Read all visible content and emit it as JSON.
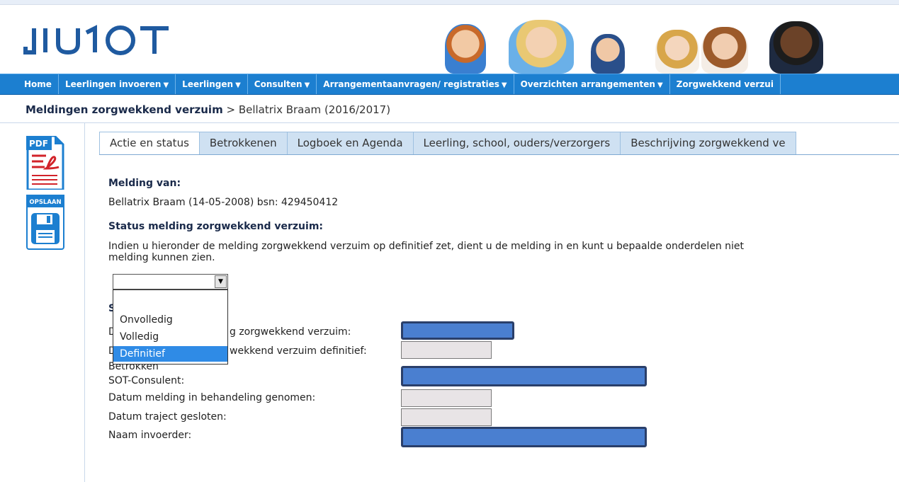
{
  "brand": {
    "logo_text": "ᒧᑌ1OT"
  },
  "nav": {
    "items": [
      {
        "label": "Home",
        "dropdown": false
      },
      {
        "label": "Leerlingen invoeren",
        "dropdown": true
      },
      {
        "label": "Leerlingen",
        "dropdown": true
      },
      {
        "label": "Consulten",
        "dropdown": true
      },
      {
        "label": "Arrangementaanvragen/ registraties",
        "dropdown": true
      },
      {
        "label": "Overzichten arrangementen",
        "dropdown": true
      },
      {
        "label": "Zorgwekkend verzui",
        "dropdown": false
      }
    ]
  },
  "breadcrumb": {
    "section": "Meldingen zorgwekkend verzuim",
    "separator": " > ",
    "current": "Bellatrix Braam (2016/2017)"
  },
  "sidebar": {
    "pdf_label": "PDF",
    "save_label": "OPSLAAN"
  },
  "tabs": [
    {
      "label": "Actie en status",
      "active": true
    },
    {
      "label": "Betrokkenen",
      "active": false
    },
    {
      "label": "Logboek en Agenda",
      "active": false
    },
    {
      "label": "Leerling, school, ouders/verzorgers",
      "active": false
    },
    {
      "label": "Beschrijving zorgwekkend ve",
      "active": false
    }
  ],
  "form": {
    "melding_van_heading": "Melding van:",
    "melding_van_value": "Bellatrix Braam (14-05-2008) bsn: 429450412",
    "status_heading": "Status melding zorgwekkend verzuim:",
    "status_info_line1": "Indien u hieronder de melding zorgwekkend verzuim op definitief zet, dient u de melding in en kunt u bepaalde onderdelen niet",
    "status_info_line2": "melding kunnen zien.",
    "status_select_value": "",
    "status_options": [
      "Onvolledig",
      "Volledig",
      "Definitief"
    ],
    "status_highlighted": "Definitief",
    "hidden_section_letter": "S",
    "rows": [
      {
        "label_prefix": "D",
        "label_visible": "g zorgwekkend verzuim:"
      },
      {
        "label_prefix": "D",
        "label_visible": "wekkend verzuim definitief:"
      },
      {
        "label": "Betrokken"
      },
      {
        "label": "SOT-Consulent:"
      },
      {
        "label": "Datum melding in behandeling genomen:"
      },
      {
        "label": "Datum traject gesloten:"
      },
      {
        "label": "Naam invoerder:"
      }
    ]
  },
  "colors": {
    "nav_bg": "#1c7fd0",
    "redacted_fill": "#4a7fd0",
    "tab_bg": "#cfe1f2",
    "selected_option": "#2f8be6"
  }
}
